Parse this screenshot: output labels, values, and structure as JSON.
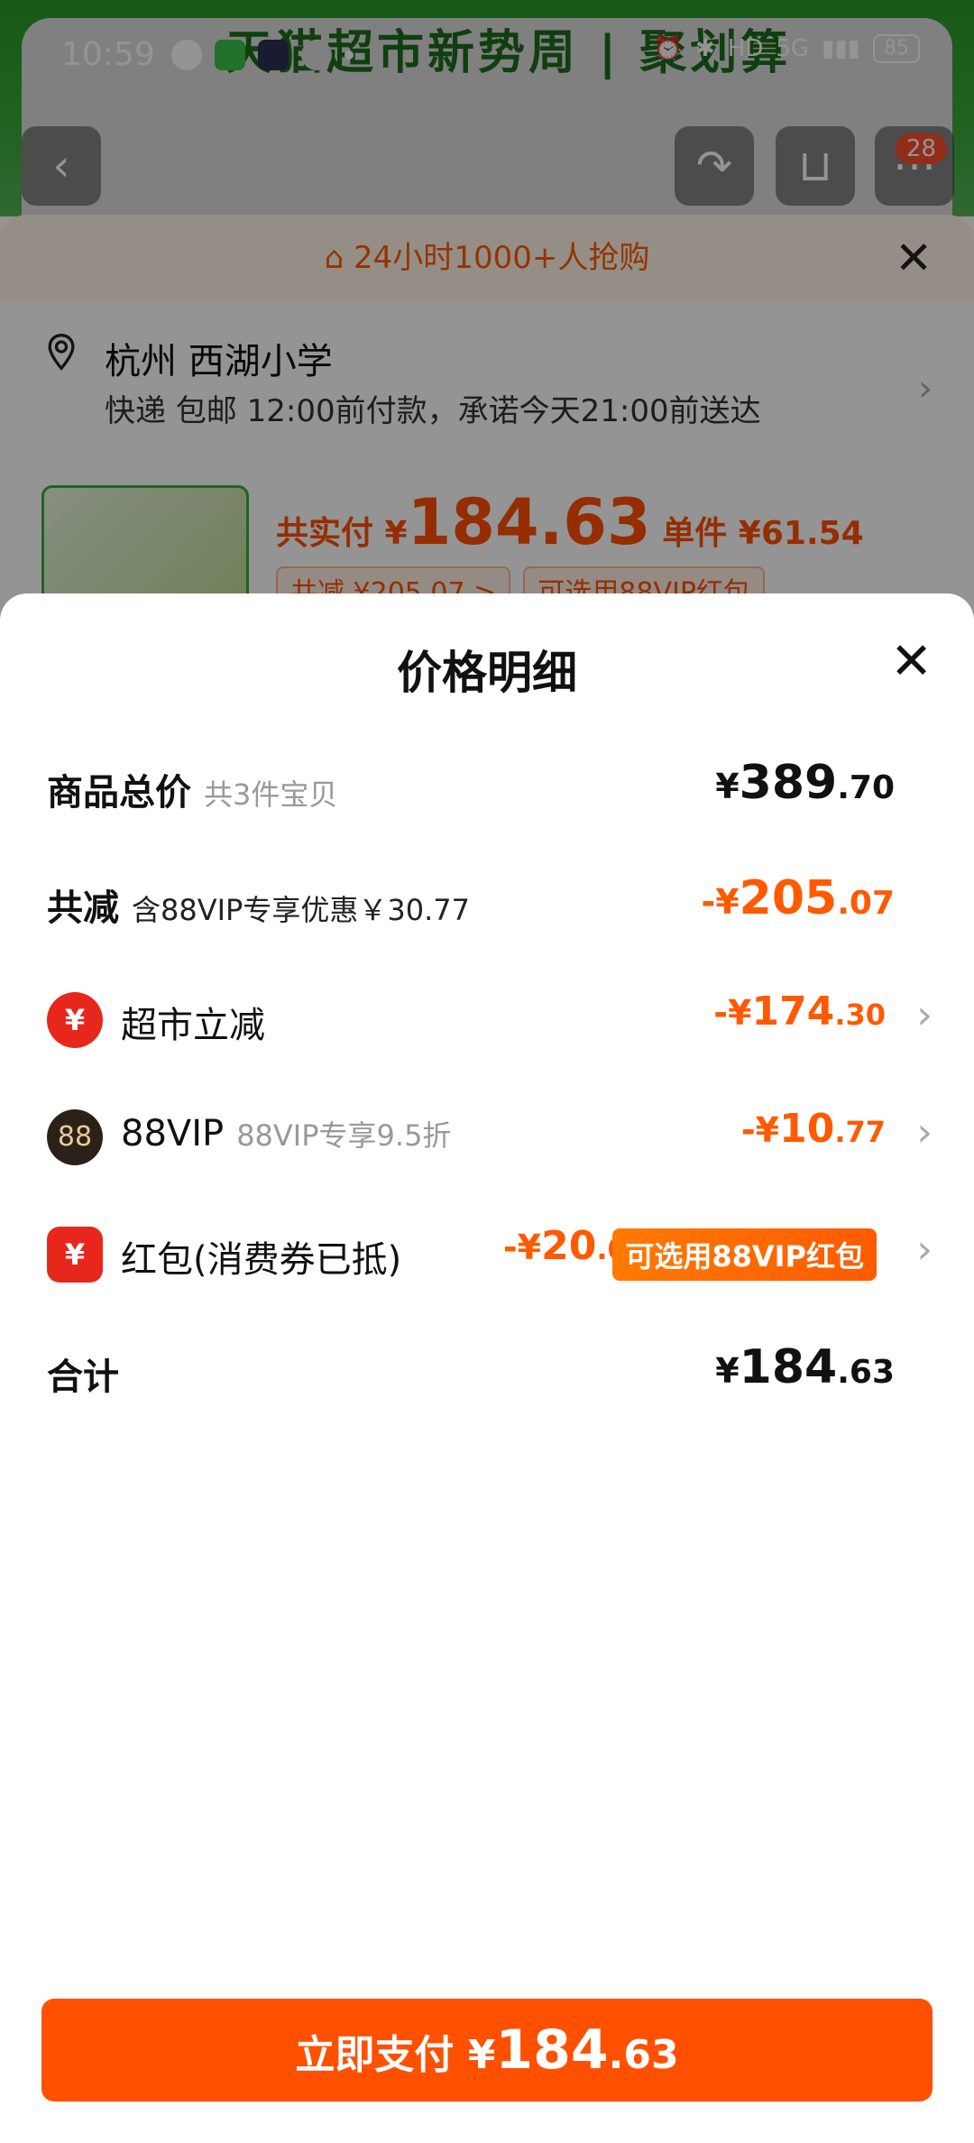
{
  "status_bar": {
    "time": "10:59",
    "battery": "85",
    "network": "5G",
    "hd": "HD"
  },
  "background": {
    "banner_title": "天猫超市新势周 | 聚划算",
    "cart_badge": "28",
    "rush_text": "24小时1000+人抢购",
    "address": {
      "name": "杭州 西湖小学",
      "shipping": "快递 包邮 12:00前付款，承诺今天21:00前送达"
    },
    "pay_summary": {
      "prefix": "共实付 ¥",
      "amount": "184.63",
      "unit_label": "单件 ¥61.54",
      "discount_tag": "共减 ¥205.07 >",
      "vip_tag": "可选用88VIP红包"
    }
  },
  "sheet": {
    "title": "价格明细",
    "total_row": {
      "label": "商品总价",
      "sub": "共3件宝贝",
      "currency": "¥",
      "int": "389",
      "dec": ".70"
    },
    "reduce_row": {
      "label": "共减",
      "sub": "含88VIP专享优惠￥30.77",
      "prefix": "-¥",
      "int": "205",
      "dec": ".07"
    },
    "items": [
      {
        "icon": "¥",
        "label": "超市立减",
        "sub": "",
        "prefix": "-¥",
        "int": "174",
        "dec": ".30"
      },
      {
        "icon": "88",
        "label": "88VIP",
        "sub": "88VIP专享9.5折",
        "prefix": "-¥",
        "int": "10",
        "dec": ".77"
      },
      {
        "icon": "¥",
        "label": "红包(消费券已抵)",
        "sub": "",
        "prefix": "-¥",
        "int": "20",
        "dec": ".00",
        "badge": "可选用88VIP红包"
      }
    ],
    "sum_row": {
      "label": "合计",
      "currency": "¥",
      "int": "184",
      "dec": ".63"
    }
  },
  "pay_button": {
    "label": "立即支付",
    "currency": "¥",
    "int": "184",
    "dec": ".63"
  },
  "colors": {
    "accent": "#ff5000",
    "discount": "#ff5a00",
    "coupon_red": "#e8271c",
    "vip_dark": "#2b2118"
  }
}
